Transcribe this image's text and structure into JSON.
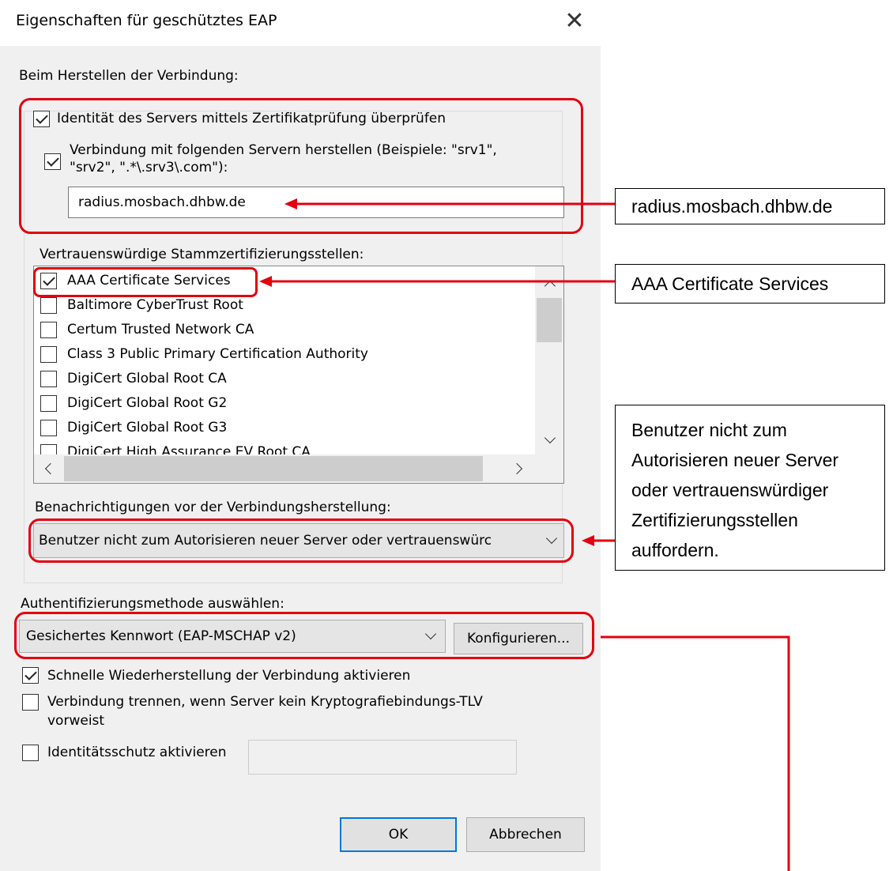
{
  "window": {
    "title": "Eigenschaften für geschütztes EAP"
  },
  "connection": {
    "heading": "Beim Herstellen der Verbindung:",
    "verify_server": {
      "label": "Identität des Servers mittels Zertifikatprüfung überprüfen",
      "checked": true
    },
    "connect_servers": {
      "label_line1": "Verbindung mit folgenden Servern herstellen (Beispiele: \"srv1\",",
      "label_line2": "\"srv2\", \".*\\.srv3\\.com\"):",
      "checked": true,
      "value": "radius.mosbach.dhbw.de"
    },
    "trusted_ca": {
      "heading": "Vertrauenswürdige Stammzertifizierungsstellen:",
      "items": [
        {
          "label": "AAA Certificate Services",
          "checked": true
        },
        {
          "label": "Baltimore CyberTrust Root",
          "checked": false
        },
        {
          "label": "Certum Trusted Network CA",
          "checked": false
        },
        {
          "label": "Class 3 Public Primary Certification Authority",
          "checked": false
        },
        {
          "label": "DigiCert Global Root CA",
          "checked": false
        },
        {
          "label": "DigiCert Global Root G2",
          "checked": false
        },
        {
          "label": "DigiCert Global Root G3",
          "checked": false
        },
        {
          "label": "DigiCert High Assurance EV Root CA",
          "checked": false
        }
      ]
    },
    "notifications": {
      "heading": "Benachrichtigungen vor der Verbindungsherstellung:",
      "selected": "Benutzer nicht zum Autorisieren neuer Server oder vertrauenswürc"
    }
  },
  "auth": {
    "heading": "Authentifizierungsmethode auswählen:",
    "selected": "Gesichertes Kennwort (EAP-MSCHAP v2)",
    "configure_label": "Konfigurieren..."
  },
  "options": {
    "fast_reconnect": {
      "label": "Schnelle Wiederherstellung der Verbindung aktivieren",
      "checked": true
    },
    "disconnect_tlv": {
      "label_line1": "Verbindung trennen, wenn Server kein Kryptografiebindungs-TLV",
      "label_line2": "vorweist",
      "checked": false
    },
    "identity_privacy": {
      "label": "Identitätsschutz aktivieren",
      "checked": false,
      "value": ""
    }
  },
  "buttons": {
    "ok": "OK",
    "cancel": "Abbrechen"
  },
  "callouts": {
    "server": "radius.mosbach.dhbw.de",
    "ca": "AAA Certificate Services",
    "notify": [
      "Benutzer nicht zum",
      "Autorisieren neuer Server",
      "oder vertrauenswürdiger",
      "Zertifizierungsstellen",
      "auffordern."
    ]
  },
  "colors": {
    "annotation": "#e3000f",
    "focus": "#0078d7"
  }
}
